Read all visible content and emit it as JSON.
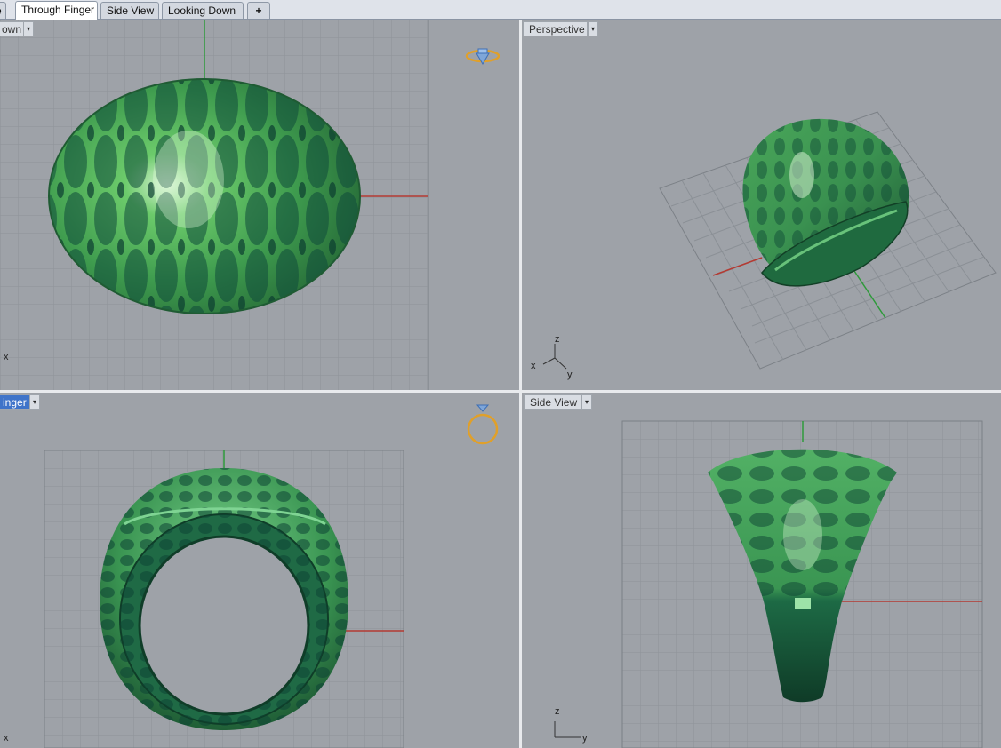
{
  "tabs": [
    {
      "label": "e",
      "active": false
    },
    {
      "label": "Through Finger",
      "active": true
    },
    {
      "label": "Side View",
      "active": false
    },
    {
      "label": "Looking Down",
      "active": false
    }
  ],
  "add_tab_symbol": "+",
  "viewports": {
    "top_left": {
      "title": "own",
      "active": false,
      "axis_x": "x"
    },
    "top_right": {
      "title": "Perspective",
      "active": false,
      "axis_x": "x",
      "axis_y": "y",
      "axis_z": "z"
    },
    "bottom_left": {
      "title": "inger",
      "active": true,
      "axis_x": "x"
    },
    "bottom_right": {
      "title": "Side View",
      "active": false,
      "axis_y": "y",
      "axis_z": "z"
    }
  },
  "dropdown_symbol": "▾",
  "icons": {
    "view_cube_top": "ring-gem-icon",
    "view_cube_bottom": "ring-front-icon"
  },
  "colors": {
    "viewport_bg": "#9ea2a8",
    "grid_minor": "#8e9399",
    "grid_major": "#7b8086",
    "axis_red": "#b43a32",
    "axis_green": "#2e9a3a",
    "ring_green": "#3f9d54",
    "active_label": "#3f74c9"
  }
}
